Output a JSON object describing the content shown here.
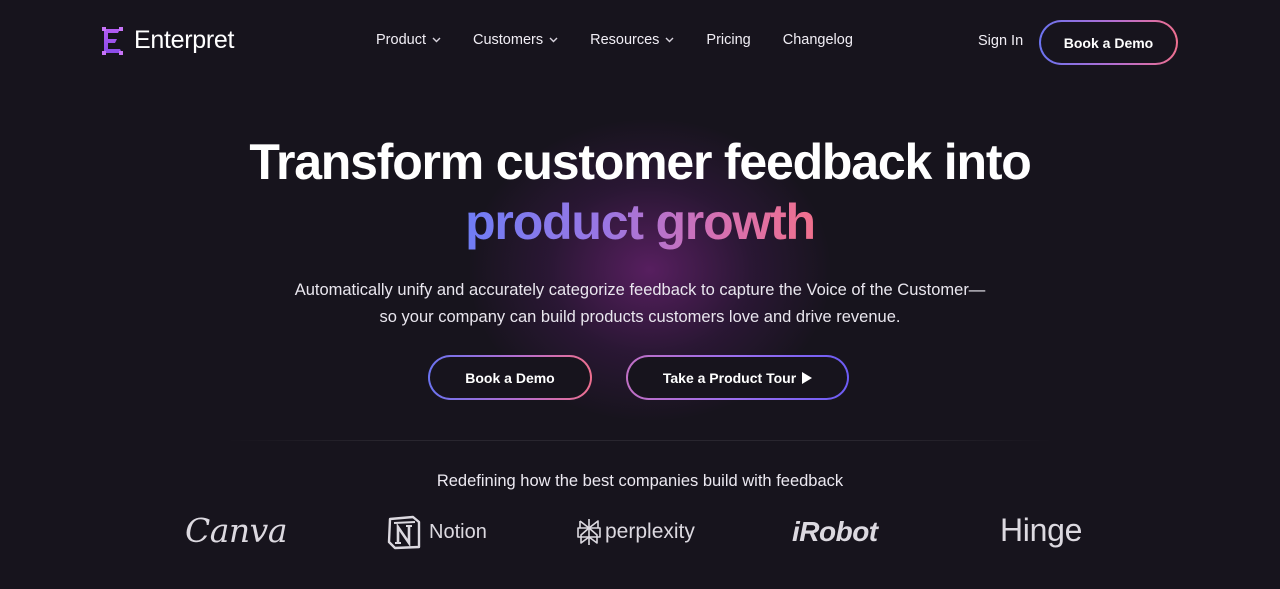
{
  "brand": {
    "name": "Enterpret",
    "logo_icon": "enterpret-e-logo",
    "accent_color": "#a55bf0"
  },
  "nav": {
    "items": [
      {
        "label": "Product",
        "has_dropdown": true
      },
      {
        "label": "Customers",
        "has_dropdown": true
      },
      {
        "label": "Resources",
        "has_dropdown": true
      },
      {
        "label": "Pricing",
        "has_dropdown": false
      },
      {
        "label": "Changelog",
        "has_dropdown": false
      }
    ],
    "sign_in_label": "Sign In",
    "book_demo_label": "Book a Demo"
  },
  "hero": {
    "title_line1": "Transform customer feedback into",
    "title_line2": "product growth",
    "subtitle_line1": "Automatically unify and accurately categorize feedback to capture the Voice of the Customer—",
    "subtitle_line2": "so your company can build products customers love and drive revenue.",
    "primary_cta": "Book a Demo",
    "secondary_cta": "Take a Product Tour",
    "secondary_cta_icon": "play-icon",
    "gradient_colors": [
      "#6f7df5",
      "#9a76e3",
      "#d270b5",
      "#f0708d"
    ]
  },
  "social_proof": {
    "caption": "Redefining how the best companies build with feedback",
    "logos": [
      {
        "name": "Canva",
        "icon": "canva-logo"
      },
      {
        "name": "Notion",
        "icon": "notion-logo"
      },
      {
        "name": "perplexity",
        "icon": "perplexity-logo"
      },
      {
        "name": "iRobot",
        "icon": "irobot-logo"
      },
      {
        "name": "Hinge",
        "icon": "hinge-logo"
      }
    ]
  }
}
